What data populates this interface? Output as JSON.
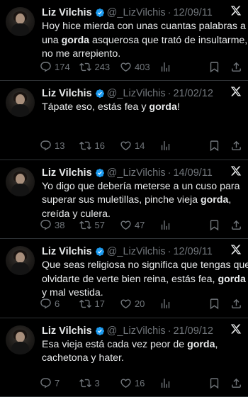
{
  "tweets": [
    {
      "name": "Liz Vilchis",
      "handle": "@_LizVilchis",
      "date": "12/09/11",
      "lines": [
        {
          "pre": "Hoy hice mierda con unas cuantas palabras a",
          "bold": "",
          "post": ""
        },
        {
          "pre": "una ",
          "bold": "gorda",
          "post": " asquerosa que trató de insultarme,"
        },
        {
          "pre": "no me arrepiento.",
          "bold": "",
          "post": ""
        }
      ],
      "replies": "174",
      "retweets": "243",
      "likes": "403",
      "views": ""
    },
    {
      "name": "Liz Vilchis",
      "handle": "@_LizVilchis",
      "date": "21/02/12",
      "lines": [
        {
          "pre": "Tápate eso, estás fea y ",
          "bold": "gorda",
          "post": "!"
        }
      ],
      "replies": "13",
      "retweets": "16",
      "likes": "14",
      "views": ""
    },
    {
      "name": "Liz Vilchis",
      "handle": "@_LizVilchis",
      "date": "14/09/11",
      "lines": [
        {
          "pre": "Yo digo que debería meterse a un cuso para",
          "bold": "",
          "post": ""
        },
        {
          "pre": "superar sus muletillas, pinche vieja ",
          "bold": "gorda",
          "post": ","
        },
        {
          "pre": "creída y culera.",
          "bold": "",
          "post": ""
        }
      ],
      "replies": "38",
      "retweets": "57",
      "likes": "47",
      "views": ""
    },
    {
      "name": "Liz Vilchis",
      "handle": "@_LizVilchis",
      "date": "12/09/11",
      "lines": [
        {
          "pre": "Que seas religiosa no significa que tengas que",
          "bold": "",
          "post": ""
        },
        {
          "pre": "olvidarte de verte bien reina, estás fea, ",
          "bold": "gorda",
          "post": ""
        },
        {
          "pre": "y mal vestida.",
          "bold": "",
          "post": ""
        }
      ],
      "replies": "6",
      "retweets": "17",
      "likes": "20",
      "views": ""
    },
    {
      "name": "Liz Vilchis",
      "handle": "@_LizVilchis",
      "date": "21/09/12",
      "lines": [
        {
          "pre": "Esa vieja está cada vez peor de ",
          "bold": "gorda",
          "post": ","
        },
        {
          "pre": "cachetona y hater.",
          "bold": "",
          "post": ""
        }
      ],
      "replies": "7",
      "retweets": "3",
      "likes": "16",
      "views": ""
    }
  ],
  "colors": {
    "background": "#000000",
    "text": "#e7e9ea",
    "muted": "#71767b",
    "verified": "#1d9bf0",
    "divider": "#2f3336"
  },
  "icons": [
    "reply-icon",
    "retweet-icon",
    "like-icon",
    "views-icon",
    "bookmark-icon",
    "share-icon",
    "verified-badge-icon",
    "x-logo-icon"
  ]
}
